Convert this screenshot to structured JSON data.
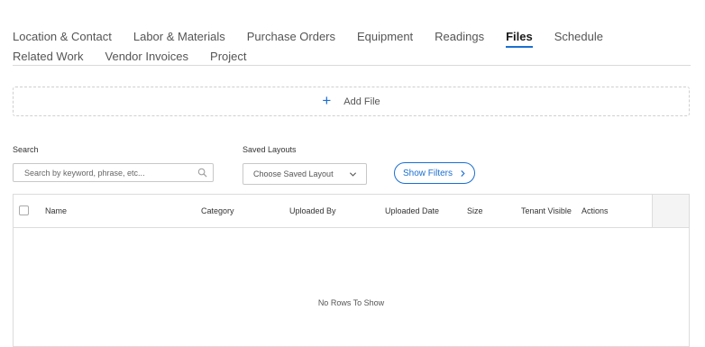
{
  "tabs": [
    {
      "label": "Location & Contact",
      "active": false
    },
    {
      "label": "Labor & Materials",
      "active": false
    },
    {
      "label": "Purchase Orders",
      "active": false
    },
    {
      "label": "Equipment",
      "active": false
    },
    {
      "label": "Readings",
      "active": false
    },
    {
      "label": "Files",
      "active": true
    },
    {
      "label": "Schedule",
      "active": false
    },
    {
      "label": "Related Work",
      "active": false
    },
    {
      "label": "Vendor Invoices",
      "active": false
    },
    {
      "label": "Project",
      "active": false
    }
  ],
  "add_file": {
    "label": "Add File",
    "icon": "plus-icon"
  },
  "search": {
    "label": "Search",
    "placeholder": "Search by keyword, phrase, etc...",
    "value": "",
    "icon": "search-icon"
  },
  "saved_layouts": {
    "label": "Saved Layouts",
    "selected": "Choose Saved Layout",
    "icon": "chevron-down-icon"
  },
  "show_filters": {
    "label": "Show Filters",
    "icon": "chevron-right-icon"
  },
  "grid": {
    "columns": [
      "Name",
      "Category",
      "Uploaded By",
      "Uploaded Date",
      "Size",
      "Tenant Visible",
      "Actions"
    ],
    "empty_message": "No Rows To Show"
  },
  "colors": {
    "accent": "#1b6fd0",
    "border": "#dcdcdc",
    "text": "#4a4a4a"
  }
}
